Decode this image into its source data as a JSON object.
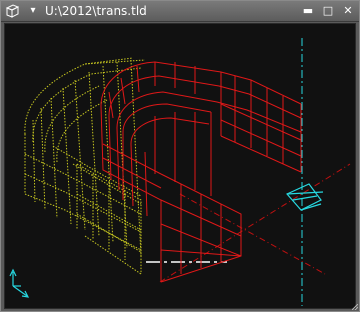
{
  "window": {
    "title": "U:\\2012\\trans.tld",
    "menu_glyph": "▾",
    "minimize_glyph": "▬",
    "maximize_glyph": "□",
    "close_glyph": "✕"
  },
  "icons": {
    "app": "cube-icon",
    "menu": "menu-arrow-icon",
    "minimize": "minimize-icon",
    "maximize": "maximize-icon",
    "close": "close-icon",
    "axis_triad": "axis-triad-icon",
    "origin_marker": "origin-marker-icon"
  },
  "colors": {
    "background": "#111111",
    "wireframe_primary": "#e01818",
    "wireframe_secondary": "#c8c820",
    "axis": "#27d8e0"
  }
}
